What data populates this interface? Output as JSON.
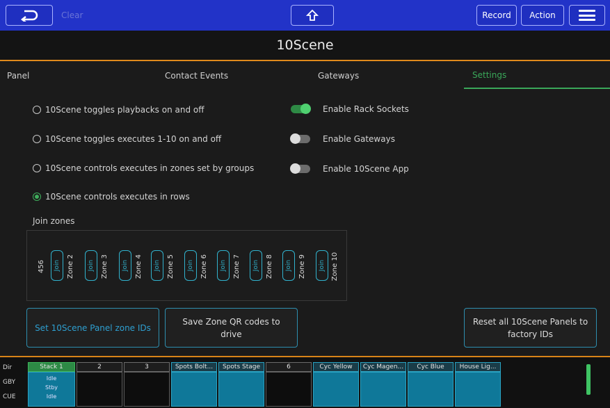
{
  "topbar": {
    "back_icon": "back-arrow-icon",
    "clear_label": "Clear",
    "home_icon": "home-up-arrow-icon",
    "record_label": "Record",
    "action_label": "Action",
    "menu_icon": "hamburger-menu-icon"
  },
  "title": "10Scene",
  "tabs": [
    "Panel",
    "Contact Events",
    "Gateways",
    "Settings"
  ],
  "active_tab": "Settings",
  "radio_options": [
    {
      "label": "10Scene toggles playbacks on and off",
      "selected": false
    },
    {
      "label": "10Scene toggles executes 1-10 on and off",
      "selected": false
    },
    {
      "label": "10Scene controls executes in zones set by groups",
      "selected": false
    },
    {
      "label": "10Scene controls executes in rows",
      "selected": true
    }
  ],
  "toggles": [
    {
      "label": "Enable Rack Sockets",
      "on": true
    },
    {
      "label": "Enable Gateways",
      "on": false
    },
    {
      "label": "Enable 10Scene App",
      "on": false
    }
  ],
  "join_zones": {
    "label": "Join zones",
    "first_label": "456",
    "join_label": "Join",
    "zones": [
      "Zone 2",
      "Zone 3",
      "Zone 4",
      "Zone 5",
      "Zone 6",
      "Zone 7",
      "Zone 8",
      "Zone 9",
      "Zone 10"
    ]
  },
  "buttons": {
    "set_ids": "Set 10Scene Panel zone IDs",
    "save_qr_line1": "Save Zone QR codes to",
    "save_qr_line2": "drive",
    "reset_line1": "Reset all 10Scene Panels to",
    "reset_line2": "factory IDs"
  },
  "playback_strip": {
    "side_labels": [
      "Dir",
      "GBY",
      "CUE"
    ],
    "playbacks": [
      {
        "label": "Stack 1",
        "style": "green",
        "sub": [
          "Idle",
          "Stby",
          "Idle"
        ]
      },
      {
        "label": "2",
        "style": "dark",
        "sub": []
      },
      {
        "label": "3",
        "style": "dark",
        "sub": []
      },
      {
        "label": "Spots Bolt...",
        "style": "teal",
        "sub": []
      },
      {
        "label": "Spots Stage",
        "style": "teal",
        "sub": []
      },
      {
        "label": "6",
        "style": "dark",
        "sub": []
      },
      {
        "label": "Cyc Yellow",
        "style": "teal",
        "sub": []
      },
      {
        "label": "Cyc Magen...",
        "style": "teal",
        "sub": []
      },
      {
        "label": "Cyc Blue",
        "style": "teal",
        "sub": []
      },
      {
        "label": "House Lig...",
        "style": "teal",
        "sub": []
      }
    ]
  },
  "colors": {
    "topbar": "#2233c8",
    "accent_orange": "#e08a1c",
    "accent_green": "#3aa85a",
    "teal": "#0f7899"
  }
}
